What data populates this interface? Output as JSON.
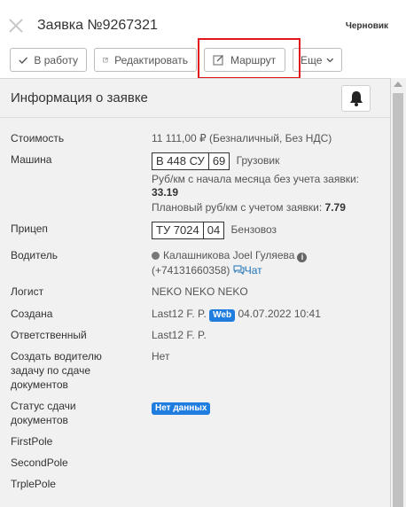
{
  "header": {
    "title": "Заявка №9267321",
    "status": "Черновик"
  },
  "toolbar": {
    "to_work": "В работу",
    "edit": "Редактировать",
    "route": "Маршрут",
    "more": "Еще"
  },
  "panel": {
    "title": "Информация о заявке",
    "fields": {
      "cost_label": "Стоимость",
      "cost_value": "11 111,00 ₽ (Безналичный, Без НДС)",
      "car_label": "Машина",
      "car_plate_main": "В 448 СУ",
      "car_plate_region": "69",
      "car_type": "Грузовик",
      "rub_km_month": "Руб/км с начала месяца без учета заявки:",
      "rub_km_month_value": "33.19",
      "planned_rub_km": "Плановый руб/км с учетом заявки:",
      "planned_rub_km_value": "7.79",
      "trailer_label": "Прицеп",
      "trailer_plate_main": "ТУ 7024",
      "trailer_plate_region": "04",
      "trailer_type": "Бензовоз",
      "driver_label": "Водитель",
      "driver_name": "Калашникова Joel Гуляева",
      "driver_phone": "(+74131660358)",
      "driver_chat": "Чат",
      "logist_label": "Логист",
      "logist_value": "NEKO NEKO NEKO",
      "created_label": "Создана",
      "created_by": "Last12 F. P.",
      "created_badge": "Web",
      "created_at": "04.07.2022 10:41",
      "responsible_label": "Ответственный",
      "responsible_value": "Last12 F. P.",
      "task_label_1": "Создать водителю",
      "task_label_2": "задачу по сдаче",
      "task_label_3": "документов",
      "task_value": "Нет",
      "docs_status_label_1": "Статус сдачи",
      "docs_status_label_2": "документов",
      "docs_status_value": "Нет данных",
      "first_pole": "FirstPole",
      "second_pole": "SecondPole",
      "triple_pole": "TrplePole"
    }
  },
  "colors": {
    "highlight": "#e3161b",
    "badge": "#1f7de0",
    "link": "#1f73b7",
    "panel_bg": "#f1f1f1"
  },
  "icons": [
    "close-icon",
    "check-icon",
    "edit-icon",
    "chevron-down-icon",
    "bell-icon",
    "info-icon",
    "chat-icon",
    "status-dot-icon"
  ]
}
